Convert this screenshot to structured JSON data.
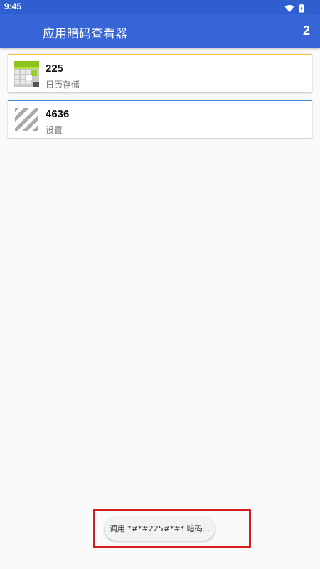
{
  "status_bar": {
    "time": "9:45",
    "icons": [
      "wifi-icon",
      "battery-icon"
    ]
  },
  "app_bar": {
    "title": "应用暗码查看器",
    "count": "2",
    "background": "#3764d6"
  },
  "list": {
    "items": [
      {
        "code": "225",
        "label": "日历存储",
        "icon": "calendar-icon",
        "accent": "#f3b73a"
      },
      {
        "code": "4636",
        "label": "设置",
        "icon": "settings-stripes-icon",
        "accent": "#3d86d8"
      }
    ]
  },
  "toast": {
    "text": "调用 *#*#225#*#* 暗码..."
  },
  "colors": {
    "highlight": "#d22020",
    "background": "#fafafa"
  }
}
